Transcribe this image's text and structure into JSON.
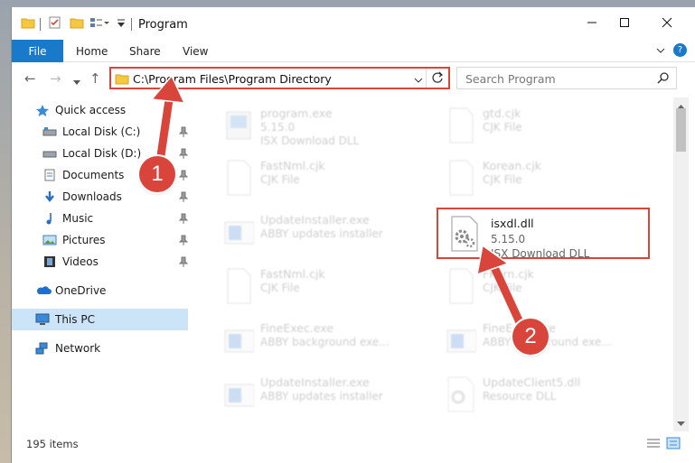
{
  "window": {
    "title": "Program"
  },
  "ribbon": {
    "file": "File",
    "home": "Home",
    "share": "Share",
    "view": "View",
    "help": "?"
  },
  "address": {
    "path": "C:\\Program Files\\Program Directory"
  },
  "search": {
    "placeholder": "Search Program"
  },
  "nav": {
    "items": [
      {
        "label": "Quick access",
        "icon": "star-icon"
      },
      {
        "label": "Local Disk (C:)",
        "icon": "drive-icon"
      },
      {
        "label": "Local Disk (D:)",
        "icon": "drive-icon"
      },
      {
        "label": "Documents",
        "icon": "documents-icon"
      },
      {
        "label": "Downloads",
        "icon": "download-icon"
      },
      {
        "label": "Music",
        "icon": "music-icon"
      },
      {
        "label": "Pictures",
        "icon": "pictures-icon"
      },
      {
        "label": "Videos",
        "icon": "videos-icon"
      },
      {
        "label": "OneDrive",
        "icon": "cloud-icon"
      },
      {
        "label": "This PC",
        "icon": "computer-icon"
      },
      {
        "label": "Network",
        "icon": "network-icon"
      }
    ]
  },
  "files": [
    {
      "name": "program.exe",
      "line1": "5.15.0",
      "line2": "ISX Download DLL",
      "icon": "program-exe-icon"
    },
    {
      "name": "gtd.cjk",
      "line1": "CJK File",
      "line2": "",
      "icon": "blank-file-icon"
    },
    {
      "name": "FastNml.cjk",
      "line1": "CJK File",
      "line2": "",
      "icon": "blank-file-icon"
    },
    {
      "name": "Korean.cjk",
      "line1": "CJK File",
      "line2": "",
      "icon": "blank-file-icon"
    },
    {
      "name": "UpdateInstaller.exe",
      "line1": "ABBY updates installer",
      "line2": "",
      "icon": "installer-icon"
    },
    {
      "name": "isxdl.dll",
      "line1": "5.15.0",
      "line2": "ISX Download DLL",
      "icon": "dll-gear-icon"
    },
    {
      "name": "FastNml.cjk",
      "line1": "CJK File",
      "line2": "",
      "icon": "blank-file-icon"
    },
    {
      "name": "FKorn.cjk",
      "line1": "CJK File",
      "line2": "",
      "icon": "blank-file-icon"
    },
    {
      "name": "FineExec.exe",
      "line1": "ABBY background exe...",
      "line2": "",
      "icon": "installer-icon"
    },
    {
      "name": "FineExec.exe",
      "line1": "ABBY background exe...",
      "line2": "",
      "icon": "installer-icon"
    },
    {
      "name": "UpdateInstaller.exe",
      "line1": "ABBY updates installer",
      "line2": "",
      "icon": "installer-icon"
    },
    {
      "name": "UpdateClient5.dll",
      "line1": "Resource DLL",
      "line2": "",
      "icon": "dll-gear-icon"
    }
  ],
  "status": {
    "count": "195 items"
  },
  "annotations": {
    "step1": "1",
    "step2": "2"
  },
  "colors": {
    "accent": "#1979ca",
    "highlight": "#d9453a",
    "selected": "#cce4f7"
  }
}
